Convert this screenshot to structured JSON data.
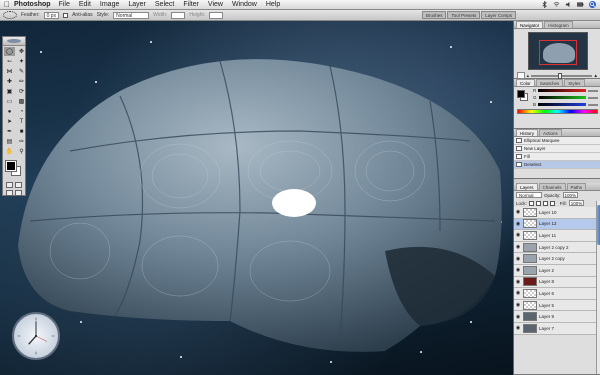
{
  "menubar": {
    "app_name": "Photoshop",
    "items": [
      "File",
      "Edit",
      "Image",
      "Layer",
      "Select",
      "Filter",
      "View",
      "Window",
      "Help"
    ]
  },
  "options": {
    "feather_label": "Feather:",
    "feather_value": "0 px",
    "antialias_label": "Anti-alias",
    "style_label": "Style:",
    "style_value": "Normal",
    "width_label": "Width:",
    "height_label": "Height:",
    "well_tabs": [
      "Brushes",
      "Tool Presets",
      "Layer Comps"
    ]
  },
  "navigator": {
    "tabs": [
      "Navigator",
      "Histogram"
    ]
  },
  "color": {
    "tabs": [
      "Color",
      "Swatches",
      "Styles"
    ],
    "rows": [
      {
        "label": "R",
        "value": "",
        "color": "#d02020"
      },
      {
        "label": "G",
        "value": "",
        "color": "#20a020"
      },
      {
        "label": "B",
        "value": "",
        "color": "#2040d0"
      }
    ]
  },
  "history": {
    "tabs": [
      "History",
      "Actions"
    ],
    "rows": [
      "Elliptical Marquee",
      "New Layer",
      "Fill",
      "Deselect"
    ]
  },
  "layers": {
    "tabs": [
      "Layers",
      "Channels",
      "Paths"
    ],
    "blend_mode": "Normal",
    "opacity_label": "Opacity:",
    "opacity_value": "100%",
    "lock_label": "Lock:",
    "fill_label": "Fill:",
    "fill_value": "100%",
    "rows": [
      {
        "name": "Layer 10",
        "thumb": "trans",
        "selected": false
      },
      {
        "name": "Layer 12",
        "thumb": "trans",
        "selected": true
      },
      {
        "name": "Layer 11",
        "thumb": "trans",
        "selected": false
      },
      {
        "name": "Layer 2 copy 2",
        "thumb": "gray",
        "selected": false
      },
      {
        "name": "Layer 2 copy",
        "thumb": "gray",
        "selected": false
      },
      {
        "name": "Layer 2",
        "thumb": "gray",
        "selected": false
      },
      {
        "name": "Layer 8",
        "thumb": "red",
        "selected": false
      },
      {
        "name": "Layer 6",
        "thumb": "trans",
        "selected": false
      },
      {
        "name": "Layer 5",
        "thumb": "trans",
        "selected": false
      },
      {
        "name": "Layer 9",
        "thumb": "dark",
        "selected": false
      },
      {
        "name": "Layer 7",
        "thumb": "dark",
        "selected": false
      }
    ]
  }
}
